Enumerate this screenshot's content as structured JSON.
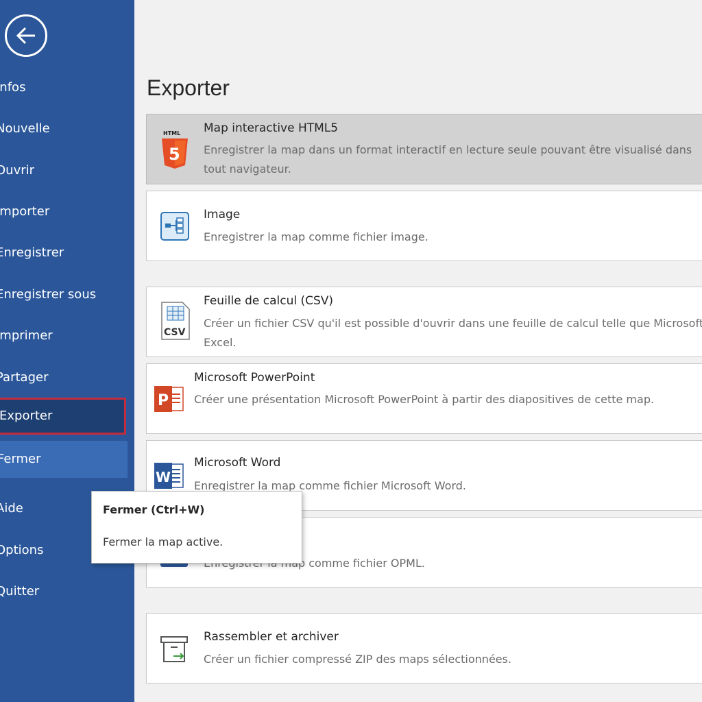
{
  "sidebar": {
    "items": [
      {
        "label": "Infos"
      },
      {
        "label": "Nouvelle"
      },
      {
        "label": "Ouvrir"
      },
      {
        "label": "Importer"
      },
      {
        "label": "Enregistrer"
      },
      {
        "label": "Enregistrer sous"
      },
      {
        "label": "Imprimer"
      },
      {
        "label": "Partager"
      },
      {
        "label": "Exporter"
      },
      {
        "label": "Fermer"
      },
      {
        "label": "Aide"
      },
      {
        "label": "Options"
      },
      {
        "label": "Quitter"
      }
    ],
    "selected": "Exporter",
    "hovered": "Fermer"
  },
  "main": {
    "title": "Exporter",
    "options": [
      {
        "title": "Map interactive HTML5",
        "description": "Enregistrer la map dans un format interactif en lecture seule pouvant être visualisé dans tout navigateur.",
        "icon": "html5-icon",
        "icon_label": "HTML"
      },
      {
        "title": "Image",
        "description": "Enregistrer la map comme fichier image.",
        "icon": "image-icon"
      },
      {
        "title": "Feuille de calcul (CSV)",
        "description": "Créer un fichier CSV qu'il est possible d'ouvrir dans une feuille de calcul telle que Microsoft Excel.",
        "icon": "csv-icon",
        "icon_label": "CSV"
      },
      {
        "title": "Microsoft PowerPoint",
        "description": "Créer une présentation Microsoft PowerPoint à partir des diapositives de cette map.",
        "icon": "powerpoint-icon",
        "icon_label": "P"
      },
      {
        "title": "Microsoft Word",
        "description": "Enregistrer la map comme fichier Microsoft Word.",
        "icon": "word-icon",
        "icon_label": "W"
      },
      {
        "title": "",
        "description": "Enregistrer la map comme fichier OPML.",
        "icon": "opml-icon"
      },
      {
        "title": "Rassembler et archiver",
        "description": "Créer un fichier compressé ZIP des maps sélectionnées.",
        "icon": "archive-icon"
      }
    ]
  },
  "tooltip": {
    "title": "Fermer (Ctrl+W)",
    "description": "Fermer la map active."
  },
  "colors": {
    "sidebar_bg": "#2b579a",
    "selected_bg": "#1e3f72",
    "selected_border": "#c42b3c",
    "html5_orange": "#e44d26",
    "powerpoint_orange": "#d24726",
    "word_blue": "#2b579a"
  }
}
